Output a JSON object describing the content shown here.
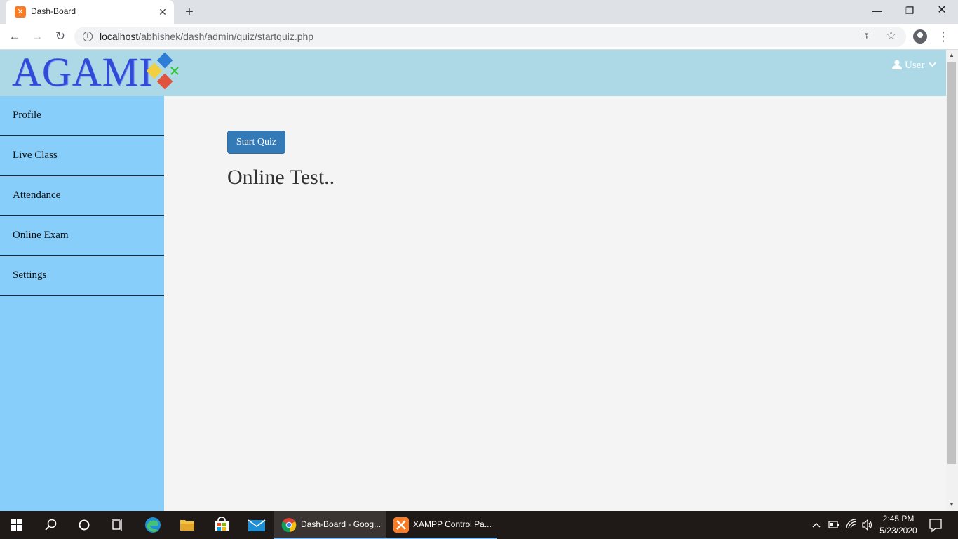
{
  "browser": {
    "tab_title": "Dash-Board",
    "tab_favicon": "xampp-icon",
    "url_host": "localhost",
    "url_path": "/abhishek/dash/admin/quiz/startquiz.php"
  },
  "header": {
    "logo_text": "AGAMI",
    "user_label": "User"
  },
  "sidebar": {
    "items": [
      {
        "label": "Profile"
      },
      {
        "label": "Live Class"
      },
      {
        "label": "Attendance"
      },
      {
        "label": "Online Exam"
      },
      {
        "label": "Settings"
      }
    ]
  },
  "main": {
    "start_button_label": "Start Quiz",
    "title": "Online Test.."
  },
  "taskbar": {
    "apps": [
      {
        "label": "Dash-Board - Goog...",
        "icon": "chrome-icon"
      },
      {
        "label": "XAMPP Control Pa...",
        "icon": "xampp-icon"
      }
    ],
    "time": "2:45 PM",
    "date": "5/23/2020"
  },
  "colors": {
    "header_bg": "#add8e6",
    "sidebar_bg": "#87cefa",
    "button_bg": "#337ab7",
    "main_bg": "#f4f4f4"
  }
}
